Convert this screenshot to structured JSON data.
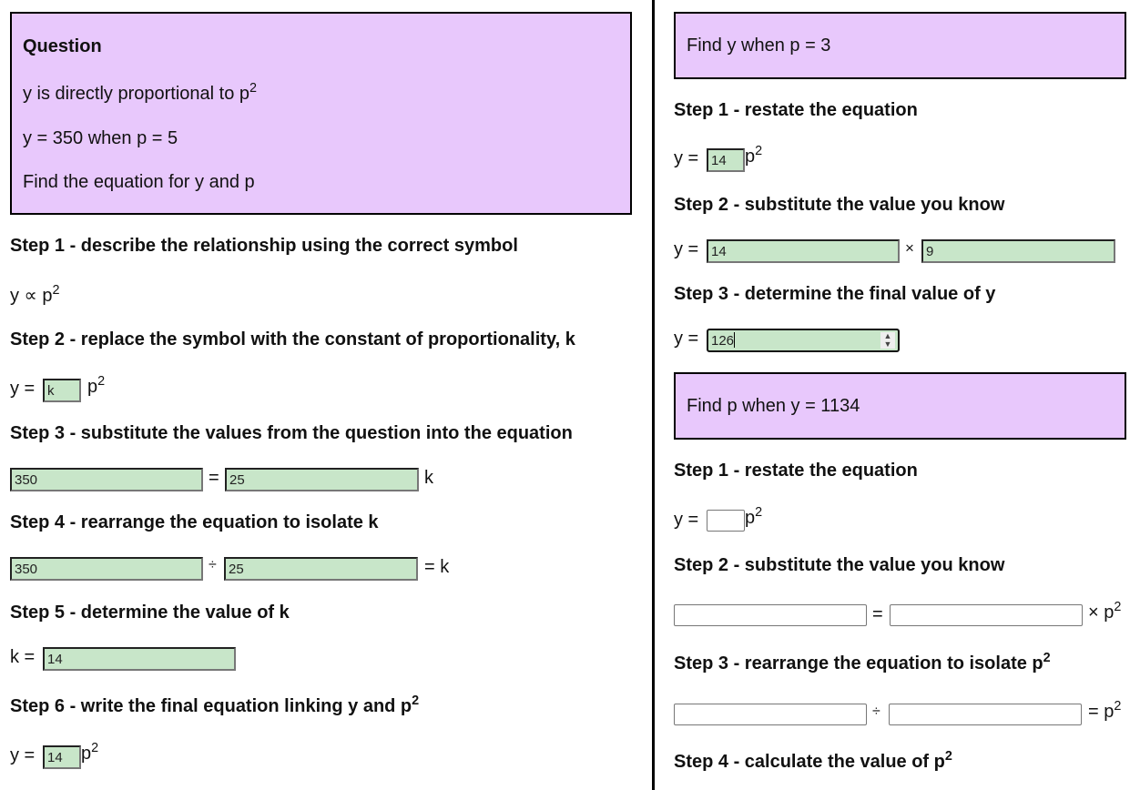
{
  "left": {
    "question": {
      "title": "Question",
      "line1_prefix": "y is directly proportional to p",
      "line1_sup": "2",
      "line2": "y = 350 when p = 5",
      "line3": "Find the equation for y and p"
    },
    "step1": {
      "label": "Step 1 - describe the relationship using the correct symbol",
      "expr_prefix": "y ∝ p",
      "expr_sup": "2"
    },
    "step2": {
      "label": "Step 2 - replace the symbol with the constant of proportionality, k",
      "prefix": "y =",
      "input_value": "k",
      "suffix": "p",
      "suffix_sup": "2"
    },
    "step3": {
      "label": "Step 3 - substitute the values from the question into the equation",
      "input1": "350",
      "operator": "=",
      "input2": "25",
      "suffix": "k"
    },
    "step4": {
      "label": "Step 4 - rearrange the equation to isolate k",
      "input1": "350",
      "operator": "÷",
      "input2": "25",
      "suffix": "= k"
    },
    "step5": {
      "label": "Step 5 - determine the value of k",
      "prefix": "k =",
      "input_value": "14"
    },
    "step6": {
      "label_prefix": "Step 6 - write the final equation linking y and p",
      "label_sup": "2",
      "prefix": "y =",
      "input_value": "14",
      "suffix": "p",
      "suffix_sup": "2"
    }
  },
  "right": {
    "part_a": {
      "prompt": "Find y when p = 3",
      "step1": {
        "label": "Step 1 - restate the equation",
        "prefix": "y =",
        "input_value": "14",
        "suffix": "p",
        "suffix_sup": "2"
      },
      "step2": {
        "label": "Step 2 - substitute the value you know",
        "prefix": "y =",
        "input1": "14",
        "operator": "×",
        "input2": "9"
      },
      "step3": {
        "label": "Step 3 - determine the final value of y",
        "prefix": "y =",
        "input_value": "126"
      }
    },
    "part_b": {
      "prompt": "Find p when y = 1134",
      "step1": {
        "label": "Step 1 - restate the equation",
        "prefix": "y =",
        "input_value": "",
        "suffix": "p",
        "suffix_sup": "2"
      },
      "step2": {
        "label": "Step 2 - substitute the value you know",
        "input1": "",
        "operator": "=",
        "input2": "",
        "suffix": "× p",
        "suffix_sup": "2"
      },
      "step3": {
        "label_prefix": "Step 3 - rearrange the equation to isolate p",
        "label_sup": "2",
        "input1": "",
        "operator": "÷",
        "input2": "",
        "suffix": "= p",
        "suffix_sup": "2"
      },
      "step4": {
        "label_prefix": "Step 4 - calculate the value of p",
        "label_sup": "2"
      }
    }
  },
  "colors": {
    "question_bg": "#e8c8fc",
    "answer_bg": "#c8e6c9"
  }
}
